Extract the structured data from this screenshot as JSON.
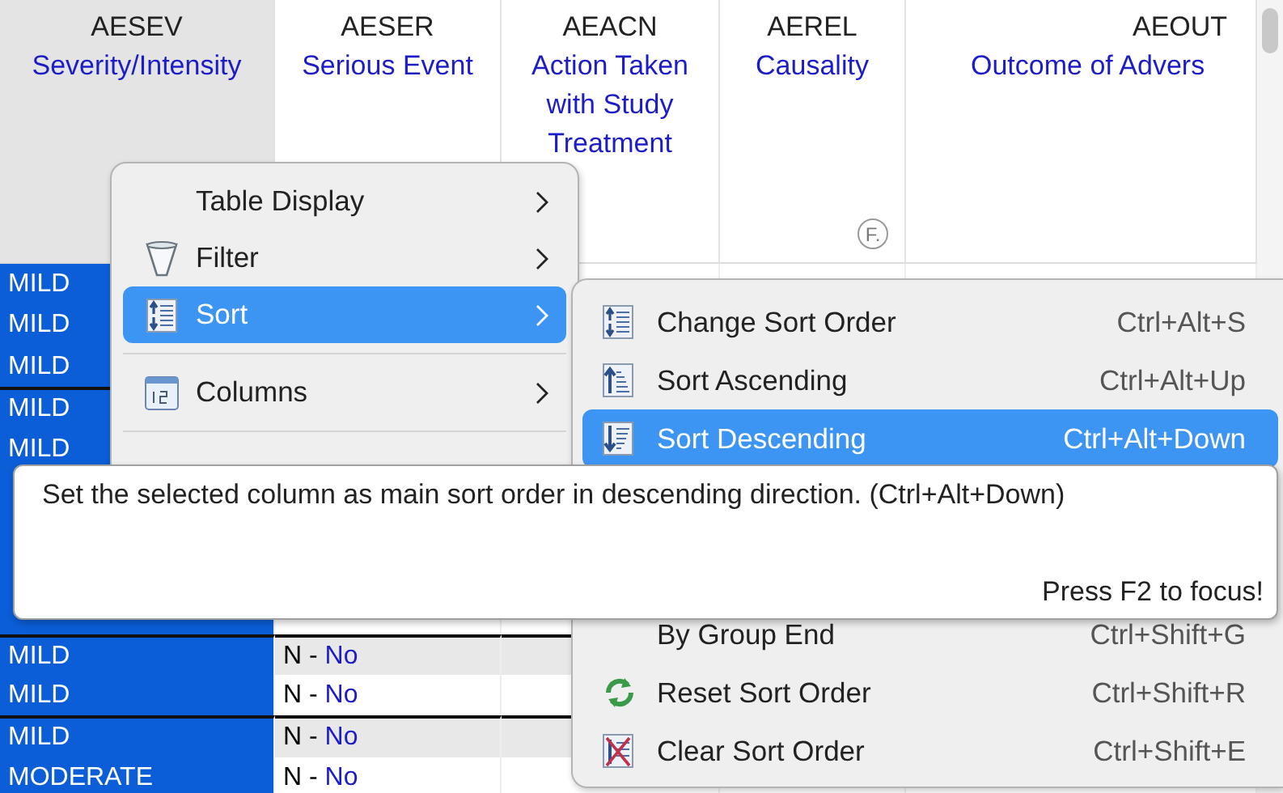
{
  "table": {
    "columns": [
      {
        "name": "AESEV",
        "label": "Severity/Intensity",
        "selected": true
      },
      {
        "name": "AESER",
        "label": "Serious Event",
        "selected": false
      },
      {
        "name": "AEACN",
        "label": "Action Taken with Study Treatment",
        "selected": false
      },
      {
        "name": "AEREL",
        "label": "Causality",
        "selected": false,
        "indicator": "F."
      },
      {
        "name": "AEOUT",
        "label": "Outcome of Advers",
        "selected": false
      }
    ],
    "upper_rows": [
      {
        "severity": "MILD",
        "group_start": false
      },
      {
        "severity": "MILD",
        "group_start": false
      },
      {
        "severity": "MILD",
        "group_start": false
      },
      {
        "severity": "MILD",
        "group_start": true
      },
      {
        "severity": "MILD",
        "group_start": false
      }
    ],
    "lower_rows": [
      {
        "severity": "MILD",
        "serious_code": "N -",
        "serious_decode": "No",
        "group_start": true
      },
      {
        "severity": "MILD",
        "serious_code": "N -",
        "serious_decode": "No",
        "group_start": false
      },
      {
        "severity": "MILD",
        "serious_code": "N -",
        "serious_decode": "No",
        "group_start": true
      },
      {
        "severity": "MODERATE",
        "serious_code": "N -",
        "serious_decode": "No",
        "group_start": false
      }
    ]
  },
  "context_menu": {
    "items": [
      {
        "kind": "item",
        "label": "Table Display",
        "selected": false
      },
      {
        "kind": "item",
        "label": "Filter",
        "selected": false
      },
      {
        "kind": "item",
        "label": "Sort",
        "selected": true
      },
      {
        "kind": "separator"
      },
      {
        "kind": "item",
        "label": "Columns",
        "selected": false
      },
      {
        "kind": "separator"
      }
    ]
  },
  "submenu": {
    "items": [
      {
        "label": "Change Sort Order",
        "shortcut": "Ctrl+Alt+S",
        "selected": false
      },
      {
        "label": "Sort Ascending",
        "shortcut": "Ctrl+Alt+Up",
        "selected": false
      },
      {
        "label": "Sort Descending",
        "shortcut": "Ctrl+Alt+Down",
        "selected": true
      }
    ],
    "lower_items": [
      {
        "label": "By Group End",
        "shortcut": "Ctrl+Shift+G",
        "selected": false
      },
      {
        "label": "Reset Sort Order",
        "shortcut": "Ctrl+Shift+R",
        "selected": false
      },
      {
        "label": "Clear Sort Order",
        "shortcut": "Ctrl+Shift+E",
        "selected": false
      }
    ]
  },
  "tooltip": {
    "text": "Set the selected column as main sort order in descending direction. (Ctrl+Alt+Down)",
    "hint": "Press F2 to focus!"
  }
}
